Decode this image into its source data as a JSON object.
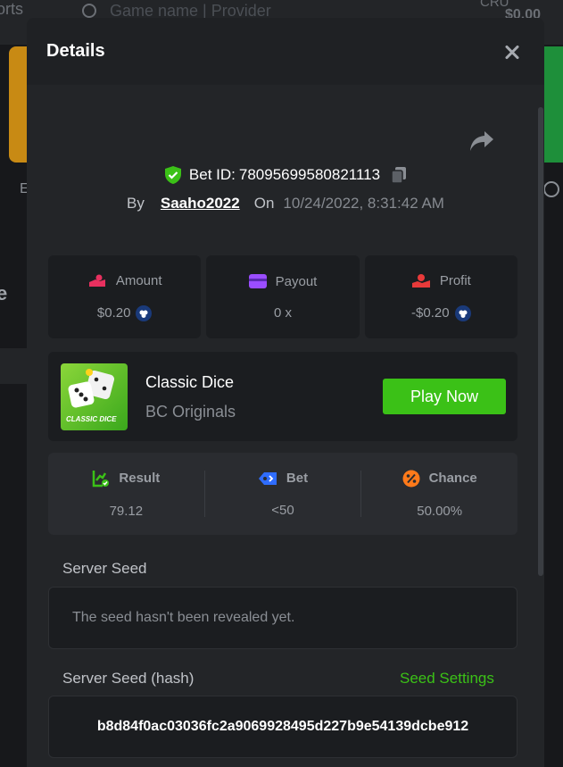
{
  "background": {
    "nav_text": "orts",
    "search_placeholder": "Game name | Provider",
    "currency": "CRU",
    "balance": "$0.00",
    "left_letter": "E",
    "left_letter2": "e"
  },
  "modal": {
    "title": "Details",
    "bet": {
      "id_label": "Bet ID:",
      "id_value": "78095699580821113",
      "by_label": "By",
      "username": "Saaho2022",
      "on_label": "On",
      "datetime": "10/24/2022, 8:31:42 AM"
    },
    "stats": [
      {
        "label": "Amount",
        "value": "$0.20",
        "icon": "hand-coins-icon",
        "has_coin": true
      },
      {
        "label": "Payout",
        "value": "0 x",
        "icon": "card-icon",
        "has_coin": false
      },
      {
        "label": "Profit",
        "value": "-$0.20",
        "icon": "hand-profit-icon",
        "has_coin": true
      }
    ],
    "game": {
      "name": "Classic Dice",
      "provider": "BC Originals",
      "thumb_label": "CLASSIC DICE",
      "play_label": "Play Now"
    },
    "result": [
      {
        "label": "Result",
        "value": "79.12",
        "icon": "result-chart-icon"
      },
      {
        "label": "Bet",
        "value": "<50",
        "icon": "bet-tag-icon"
      },
      {
        "label": "Chance",
        "value": "50.00%",
        "icon": "percent-icon"
      }
    ],
    "server_seed": {
      "label": "Server Seed",
      "value": "The seed hasn't been revealed yet."
    },
    "server_seed_hash": {
      "label": "Server Seed (hash)",
      "settings_label": "Seed Settings",
      "value": "b8d84f0ac03036fc2a9069928495d227b9e54139dcbe912"
    }
  },
  "colors": {
    "accent_green": "#3bc117",
    "modal_bg": "#232528",
    "panel_bg": "#1b1d20"
  }
}
